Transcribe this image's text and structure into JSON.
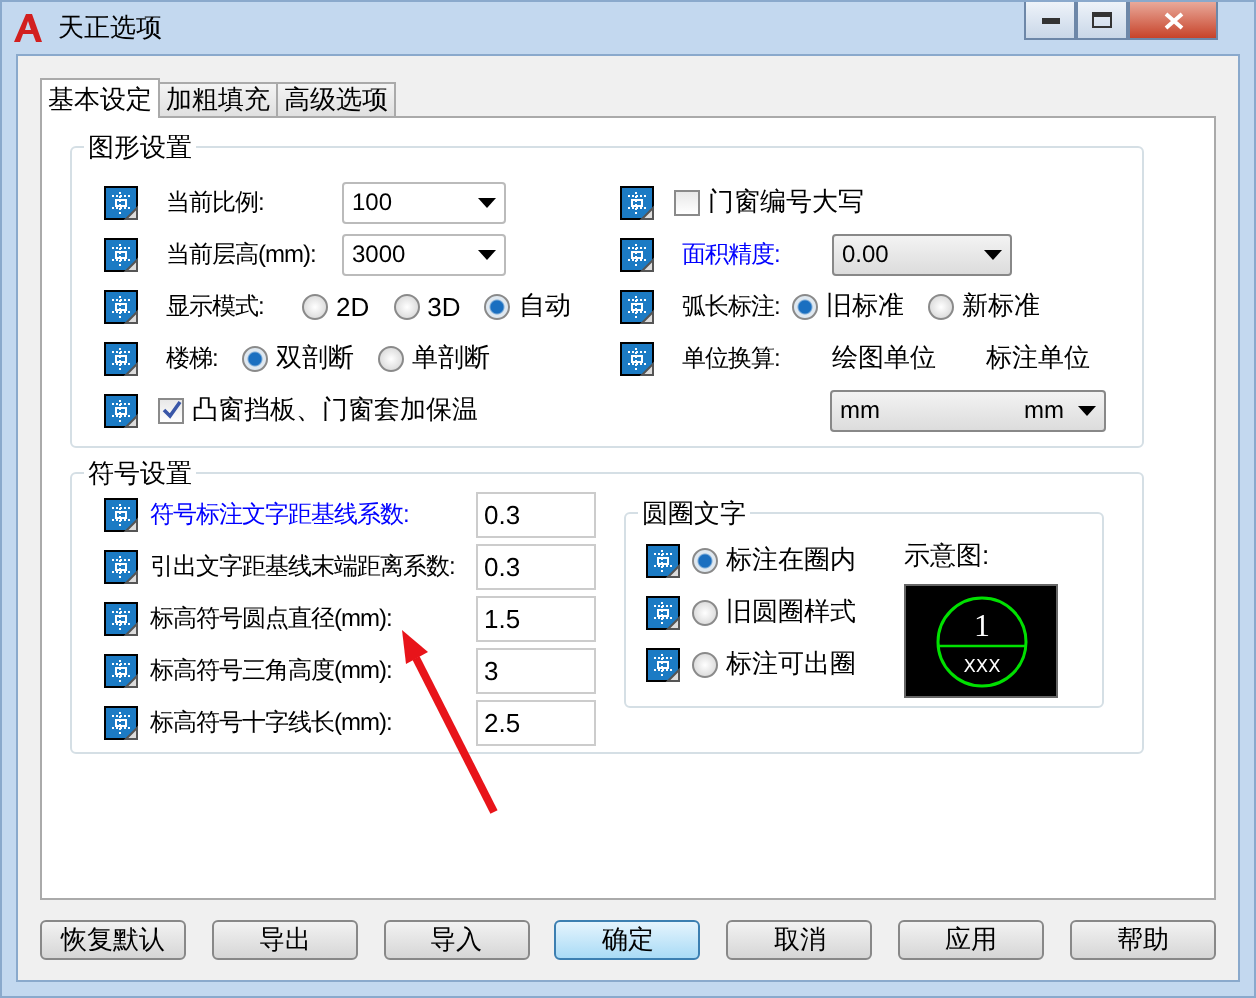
{
  "window": {
    "title": "天正选项"
  },
  "tabs": [
    {
      "label": "基本设定",
      "selected": true
    },
    {
      "label": "加粗填充",
      "selected": false
    },
    {
      "label": "高级选项",
      "selected": false
    }
  ],
  "graphics": {
    "title": "图形设置",
    "left": [
      {
        "kind": "combo",
        "label": "当前比例:",
        "value": "100"
      },
      {
        "kind": "combo",
        "label": "当前层高(mm):",
        "value": "3000"
      },
      {
        "kind": "radio",
        "label": "显示模式:",
        "options": [
          {
            "label": "2D",
            "selected": false
          },
          {
            "label": "3D",
            "selected": false
          },
          {
            "label": "自动",
            "selected": true
          }
        ]
      },
      {
        "kind": "radio",
        "label": "楼梯:",
        "options": [
          {
            "label": "双剖断",
            "selected": true
          },
          {
            "label": "单剖断",
            "selected": false
          }
        ]
      },
      {
        "kind": "checkbox",
        "label": "凸窗挡板、门窗套加保温",
        "checked": true
      }
    ],
    "right": [
      {
        "kind": "checkbox",
        "label": "门窗编号大写",
        "checked": false
      },
      {
        "kind": "dropdown",
        "label": "面积精度:",
        "value": "0.00",
        "highlighted": true
      },
      {
        "kind": "radio",
        "label": "弧长标注:",
        "options": [
          {
            "label": "旧标准",
            "selected": true
          },
          {
            "label": "新标准",
            "selected": false
          }
        ]
      },
      {
        "kind": "units",
        "label": "单位换算:",
        "column_1": "绘图单位",
        "column_2": "标注单位",
        "value_1": "mm",
        "value_2": "mm"
      }
    ]
  },
  "symbols": {
    "title": "符号设置",
    "fields": [
      {
        "label": "符号标注文字距基线系数:",
        "value": "0.3",
        "highlighted": true
      },
      {
        "label": "引出文字距基线末端距离系数:",
        "value": "0.3",
        "highlighted": false
      },
      {
        "label": "标高符号圆点直径(mm):",
        "value": "1.5",
        "highlighted": false
      },
      {
        "label": "标高符号三角高度(mm):",
        "value": "3",
        "highlighted": false
      },
      {
        "label": "标高符号十字线长(mm):",
        "value": "2.5",
        "highlighted": false
      }
    ],
    "circle_text": {
      "title": "圆圈文字",
      "options": [
        {
          "label": "标注在圈内",
          "selected": true
        },
        {
          "label": "旧圆圈样式",
          "selected": false
        },
        {
          "label": "标注可出圈",
          "selected": false
        }
      ],
      "preview_label": "示意图:",
      "preview_number": "1",
      "preview_text": "XXX"
    }
  },
  "buttons": [
    {
      "label": "恢复默认",
      "default": false
    },
    {
      "label": "导出",
      "default": false
    },
    {
      "label": "导入",
      "default": false
    },
    {
      "label": "确定",
      "default": true
    },
    {
      "label": "取消",
      "default": false
    },
    {
      "label": "应用",
      "default": false
    },
    {
      "label": "帮助",
      "default": false
    }
  ]
}
